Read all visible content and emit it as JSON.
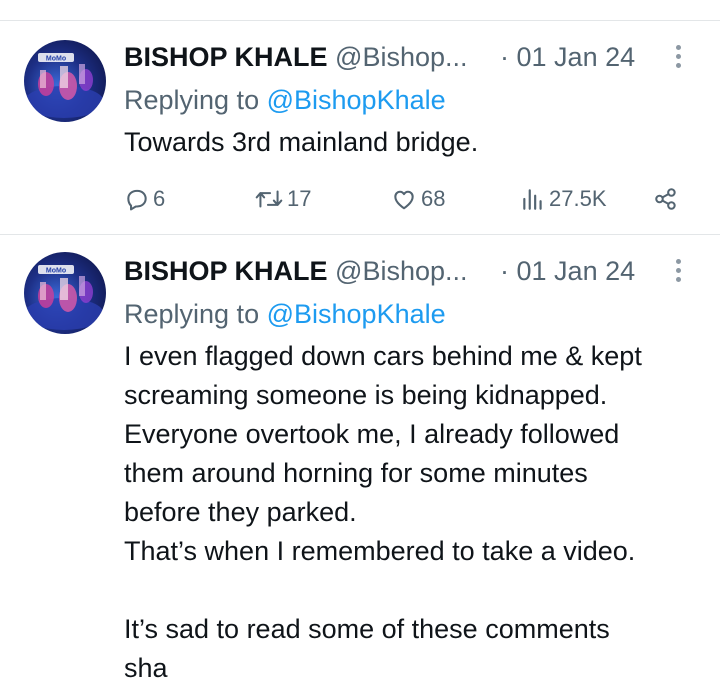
{
  "tweets": [
    {
      "name": "BISHOP KHALE",
      "handle": "@Bishop...",
      "separator": "·",
      "date": "01 Jan 24",
      "replying_prefix": "Replying to",
      "replying_to": "@BishopKhale",
      "lines": [
        "Towards 3rd mainland bridge."
      ],
      "stats": {
        "replies": "6",
        "retweets": "17",
        "likes": "68",
        "views": "27.5K"
      }
    },
    {
      "name": "BISHOP KHALE",
      "handle": "@Bishop...",
      "separator": "·",
      "date": "01 Jan 24",
      "replying_prefix": "Replying to",
      "replying_to": "@BishopKhale",
      "lines": [
        "I even flagged down cars behind me & kept",
        "screaming someone is being kidnapped.",
        "Everyone overtook me, I already followed",
        "them around horning for some minutes",
        "before they parked.",
        "That’s when I remembered to take a video.",
        "",
        "It’s sad to read some of these comments",
        "sha"
      ]
    }
  ],
  "icons": {
    "reply": "reply-icon",
    "retweet": "retweet-icon",
    "like": "heart-icon",
    "views": "views-icon",
    "share": "share-icon",
    "more": "more-icon"
  },
  "colors": {
    "text": "#0f1419",
    "muted": "#536471",
    "link": "#1d9bf0",
    "divider": "#e3e6e8"
  }
}
